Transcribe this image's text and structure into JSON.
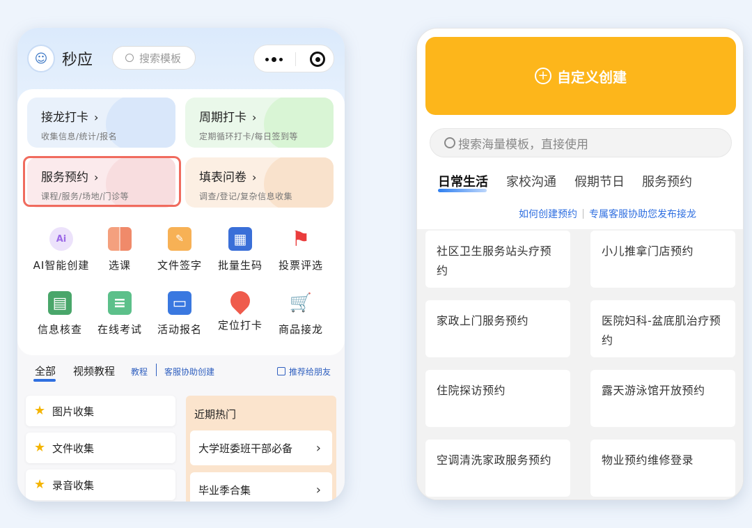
{
  "left": {
    "header": {
      "app_name": "秒应",
      "logo_glyph": "☺",
      "search_placeholder": "搜索模板"
    },
    "cards": [
      {
        "title": "接龙打卡",
        "subtitle": "收集信息/统计/报名"
      },
      {
        "title": "周期打卡",
        "subtitle": "定期循环打卡/每日签到等"
      },
      {
        "title": "服务预约",
        "subtitle": "课程/服务/场地/门诊等"
      },
      {
        "title": "填表问卷",
        "subtitle": "调查/登记/复杂信息收集"
      }
    ],
    "card_chevron": "›",
    "grid": [
      {
        "label": "AI智能创建",
        "icon": "ai-icon",
        "glyph": "Ai",
        "color": "#b688f0"
      },
      {
        "label": "选课",
        "icon": "book-icon",
        "glyph": "",
        "color": "#f08a6a"
      },
      {
        "label": "文件签字",
        "icon": "sign-icon",
        "glyph": "✎",
        "color": "#f7a948"
      },
      {
        "label": "批量生码",
        "icon": "qrcode-icon",
        "glyph": "▦",
        "color": "#3a6fd8"
      },
      {
        "label": "投票评选",
        "icon": "flag-icon",
        "glyph": "⚑",
        "color": "#ea3d3d"
      },
      {
        "label": "信息核查",
        "icon": "calendar-icon",
        "glyph": "▤",
        "color": "#49a66a"
      },
      {
        "label": "在线考试",
        "icon": "exam-icon",
        "glyph": "≡",
        "color": "#5cc08a"
      },
      {
        "label": "活动报名",
        "icon": "screen-icon",
        "glyph": "▭",
        "color": "#3a78e0"
      },
      {
        "label": "定位打卡",
        "icon": "location-icon",
        "glyph": "●",
        "color": "#ef5b4c"
      },
      {
        "label": "商品接龙",
        "icon": "cart-icon",
        "glyph": "🛒",
        "color": "#f6a516"
      }
    ],
    "tabs": {
      "all": "全部",
      "video": "视频教程",
      "tutorial": "教程",
      "service": "客服协助创建",
      "recommend": "推荐给朋友"
    },
    "collections": [
      "图片收集",
      "文件收集",
      "录音收集"
    ],
    "hot": {
      "title": "近期热门",
      "items": [
        "大学班委班干部必备",
        "毕业季合集"
      ]
    }
  },
  "right": {
    "custom_create": "自定义创建",
    "search_placeholder": "搜索海量模板，直接使用",
    "tabs": [
      "日常生活",
      "家校沟通",
      "假期节日",
      "服务预约"
    ],
    "links": [
      "如何创建预约",
      "专属客服协助您发布接龙"
    ],
    "templates": [
      "社区卫生服务站头疗预约",
      "小儿推拿门店预约",
      "家政上门服务预约",
      "医院妇科-盆底肌治疗预约",
      "住院探访预约",
      "露天游泳馆开放预约",
      "空调清洗家政服务预约",
      "物业预约维修登录"
    ]
  },
  "colors": {
    "accent_orange": "#fdb61b",
    "accent_blue": "#2f6fe0",
    "highlight_red": "#f06b5e"
  }
}
